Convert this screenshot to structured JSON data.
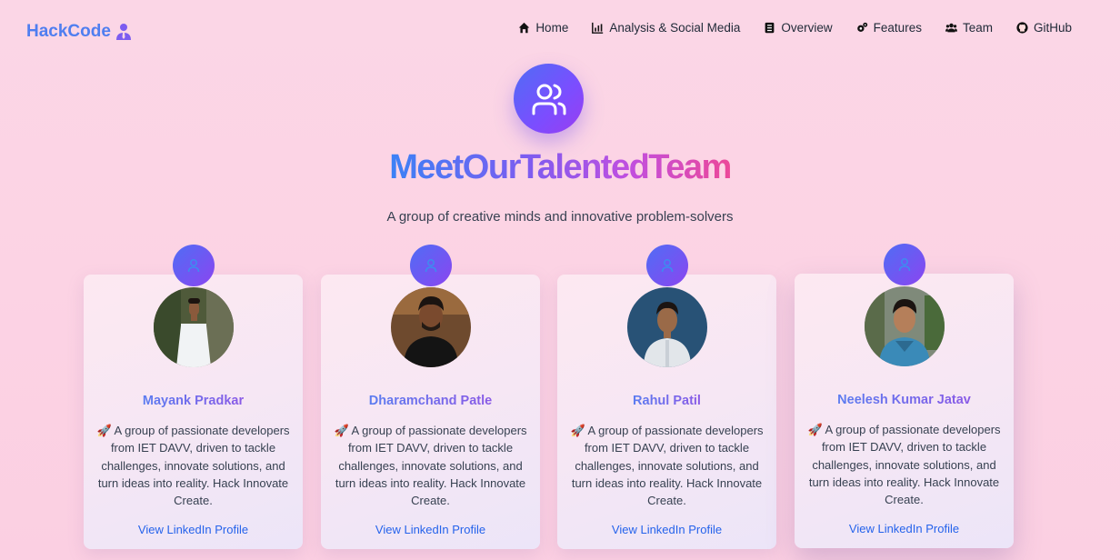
{
  "nav": {
    "brand": "HackCode",
    "items": [
      {
        "label": "Home",
        "icon": "home-icon"
      },
      {
        "label": "Analysis & Social Media",
        "icon": "chart-icon"
      },
      {
        "label": "Overview",
        "icon": "document-icon"
      },
      {
        "label": "Features",
        "icon": "gears-icon"
      },
      {
        "label": "Team",
        "icon": "users-icon"
      },
      {
        "label": "GitHub",
        "icon": "github-icon"
      }
    ]
  },
  "hero": {
    "icon": "team-icon",
    "title": "MeetOurTalentedTeam",
    "subtitle": "A group of creative minds and innovative problem-solvers"
  },
  "colors": {
    "accent_blue": "#3b82f6",
    "accent_purple": "#7c4dff",
    "accent_pink": "#ec4899",
    "link": "#2563eb",
    "page_bg": "#fcd3e4"
  },
  "team": [
    {
      "name": "Mayank Pradkar",
      "description": "🚀 A group of passionate developers from IET DAVV, driven to tackle challenges, innovate solutions, and turn ideas into reality. Hack Innovate Create.",
      "link": "View LinkedIn Profile"
    },
    {
      "name": "Dharamchand Patle",
      "description": "🚀 A group of passionate developers from IET DAVV, driven to tackle challenges, innovate solutions, and turn ideas into reality. Hack Innovate Create.",
      "link": "View LinkedIn Profile"
    },
    {
      "name": "Rahul Patil",
      "description": "🚀 A group of passionate developers from IET DAVV, driven to tackle challenges, innovate solutions, and turn ideas into reality. Hack Innovate Create.",
      "link": "View LinkedIn Profile"
    },
    {
      "name": "Neelesh Kumar Jatav",
      "description": "🚀 A group of passionate developers from IET DAVV, driven to tackle challenges, innovate solutions, and turn ideas into reality. Hack Innovate Create.",
      "link": "View LinkedIn Profile"
    }
  ]
}
